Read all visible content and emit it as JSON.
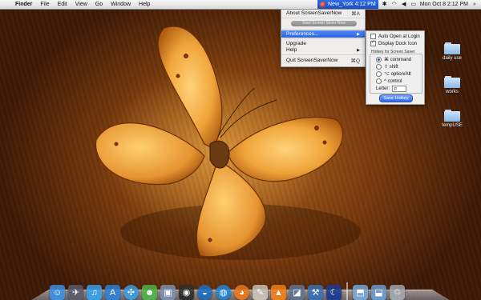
{
  "menubar": {
    "apple_icon": "apple-logo-icon",
    "items": [
      "Finder",
      "File",
      "Edit",
      "View",
      "Go",
      "Window",
      "Help"
    ],
    "clock_city": "New_York 4:12 PM",
    "datetime": "Mon Oct 8  2:12 PM",
    "status_icons": [
      "screensavernow-icon",
      "bluetooth-icon",
      "wifi-icon",
      "volume-icon",
      "battery-icon",
      "spotlight-icon"
    ]
  },
  "dropdown": {
    "about": "About ScreenSaverNow",
    "about_shortcut": "⌘A",
    "start_button": "Start Screen Saver Now",
    "preferences": "Preferences...",
    "upgrade": "Upgrade",
    "help": "Help",
    "quit": "Quit ScreenSaverNow",
    "quit_shortcut": "⌘Q"
  },
  "preferences": {
    "auto_open": {
      "label": "Auto Open at Login",
      "checked": false
    },
    "display_dock": {
      "label": "Display Dock Icon",
      "checked": true
    },
    "hotkey_group_label": "Hotkey for Screen Saver",
    "modifiers": [
      {
        "label": "⌘ command",
        "selected": true
      },
      {
        "label": "⇧ shift",
        "selected": false
      },
      {
        "label": "⌥ option/Alt",
        "selected": false
      },
      {
        "label": "^ control",
        "selected": false
      }
    ],
    "letter_label": "Letter:",
    "letter_value": "p",
    "save_button": "Save Hotkey"
  },
  "desktop_folders": [
    "daily use",
    "works",
    "tempUSE"
  ],
  "dock": {
    "icons": [
      {
        "name": "finder-icon",
        "bg": "#3d8fe0",
        "glyph": "☺"
      },
      {
        "name": "launchpad-icon",
        "bg": "#5b5b6b",
        "glyph": "✈"
      },
      {
        "name": "itunes-icon",
        "bg": "#3aa0e8",
        "glyph": "♫"
      },
      {
        "name": "app-store-icon",
        "bg": "#2d7fd6",
        "glyph": "A"
      },
      {
        "name": "safari-icon",
        "bg": "#3c9be0",
        "glyph": "✣"
      },
      {
        "name": "ichat-icon",
        "bg": "#4db34a",
        "glyph": "☻"
      },
      {
        "name": "preview-icon",
        "bg": "#7d8fb0",
        "glyph": "▣"
      },
      {
        "name": "photo-booth-icon",
        "bg": "#2e2e2e",
        "glyph": "◉"
      },
      {
        "name": "google-earth-icon",
        "bg": "#1a6fc0",
        "glyph": "◒"
      },
      {
        "name": "network-icon",
        "bg": "#1f86d8",
        "glyph": "◍"
      },
      {
        "name": "firefox-icon",
        "bg": "#e8761c",
        "glyph": "◕"
      },
      {
        "name": "textedit-icon",
        "bg": "#c9c2b5",
        "glyph": "✎"
      },
      {
        "name": "vlc-icon",
        "bg": "#f07f18",
        "glyph": "▲"
      },
      {
        "name": "terminal-icon",
        "bg": "#5f7490",
        "glyph": "◪"
      },
      {
        "name": "xcode-icon",
        "bg": "#3b6fb4",
        "glyph": "⚒"
      },
      {
        "name": "screensaver-now-icon",
        "bg": "#1d3a8f",
        "glyph": "☾"
      },
      {
        "name": "applications-stack-icon",
        "bg": "#7aa7d6",
        "glyph": "⬒"
      },
      {
        "name": "downloads-stack-icon",
        "bg": "#6c9acf",
        "glyph": "⬓"
      },
      {
        "name": "trash-icon",
        "bg": "#a0a6ad",
        "glyph": "♲"
      }
    ]
  }
}
